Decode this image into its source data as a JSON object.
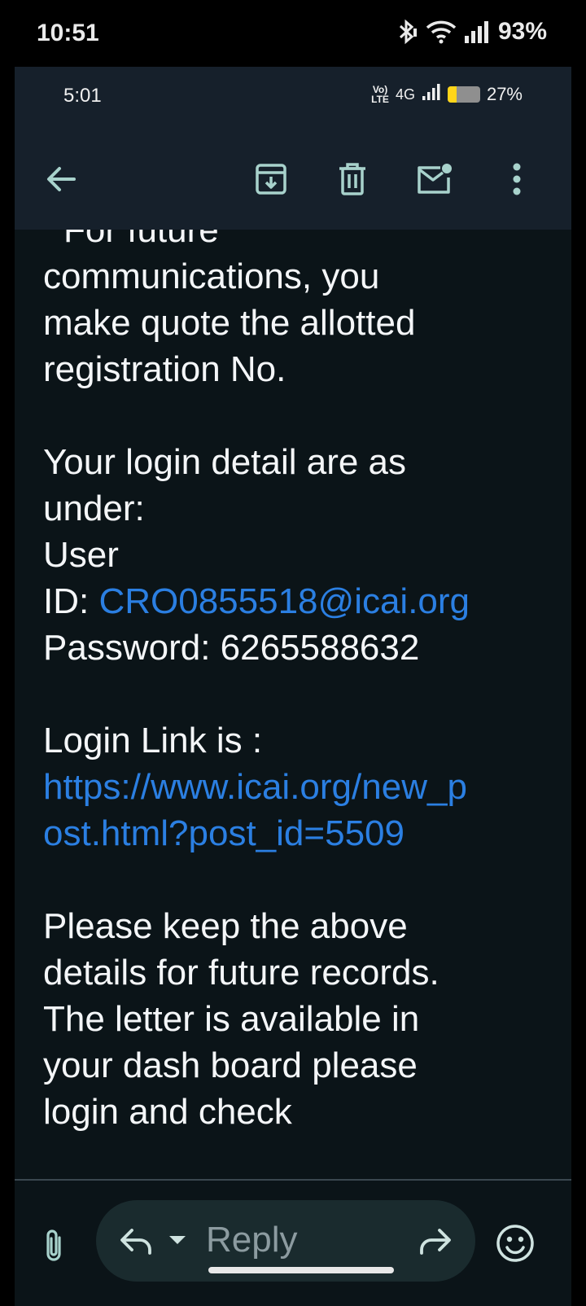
{
  "outer_status": {
    "time": "10:51",
    "battery_label": "93%",
    "icons": [
      "bluetooth-icon",
      "wifi-icon",
      "signal-icon"
    ]
  },
  "inner_status": {
    "time": "5:01",
    "volte_top": "Vo)",
    "volte_bottom": "LTE",
    "network": "4G",
    "battery_label": "27%",
    "battery_level": 0.27
  },
  "toolbar": {
    "icons": [
      "back-arrow-icon",
      "archive-icon",
      "delete-icon",
      "mark-unread-icon",
      "more-vert-icon"
    ]
  },
  "email": {
    "line_1": "For future",
    "line_2": "communications,  you",
    "line_3": "make quote the allotted",
    "line_4": "registration No.",
    "login_intro_1": "Your login detail are as",
    "login_intro_2": "under:",
    "user_label": "User",
    "id_label": "ID: ",
    "user_id": "CRO0855518@icai.org",
    "password_line": "Password:  6265588632",
    "login_link_label": "Login Link is :",
    "login_link_1": "https://www.icai.org/new_p",
    "login_link_2": "ost.html?post_id=5509",
    "keep_1": "Please keep the above",
    "keep_2": "details for future records.",
    "keep_3": "The letter is available in",
    "keep_4": "your dash board please",
    "keep_5": "login and check"
  },
  "reply_bar": {
    "reply_label": "Reply",
    "icons": [
      "attachment-icon",
      "reply-icon",
      "forward-icon",
      "emoji-icon"
    ]
  },
  "colors": {
    "background": "#0b1418",
    "toolbar": "#16202b",
    "link": "#2b7fe2",
    "icon": "#a8d2cc"
  }
}
